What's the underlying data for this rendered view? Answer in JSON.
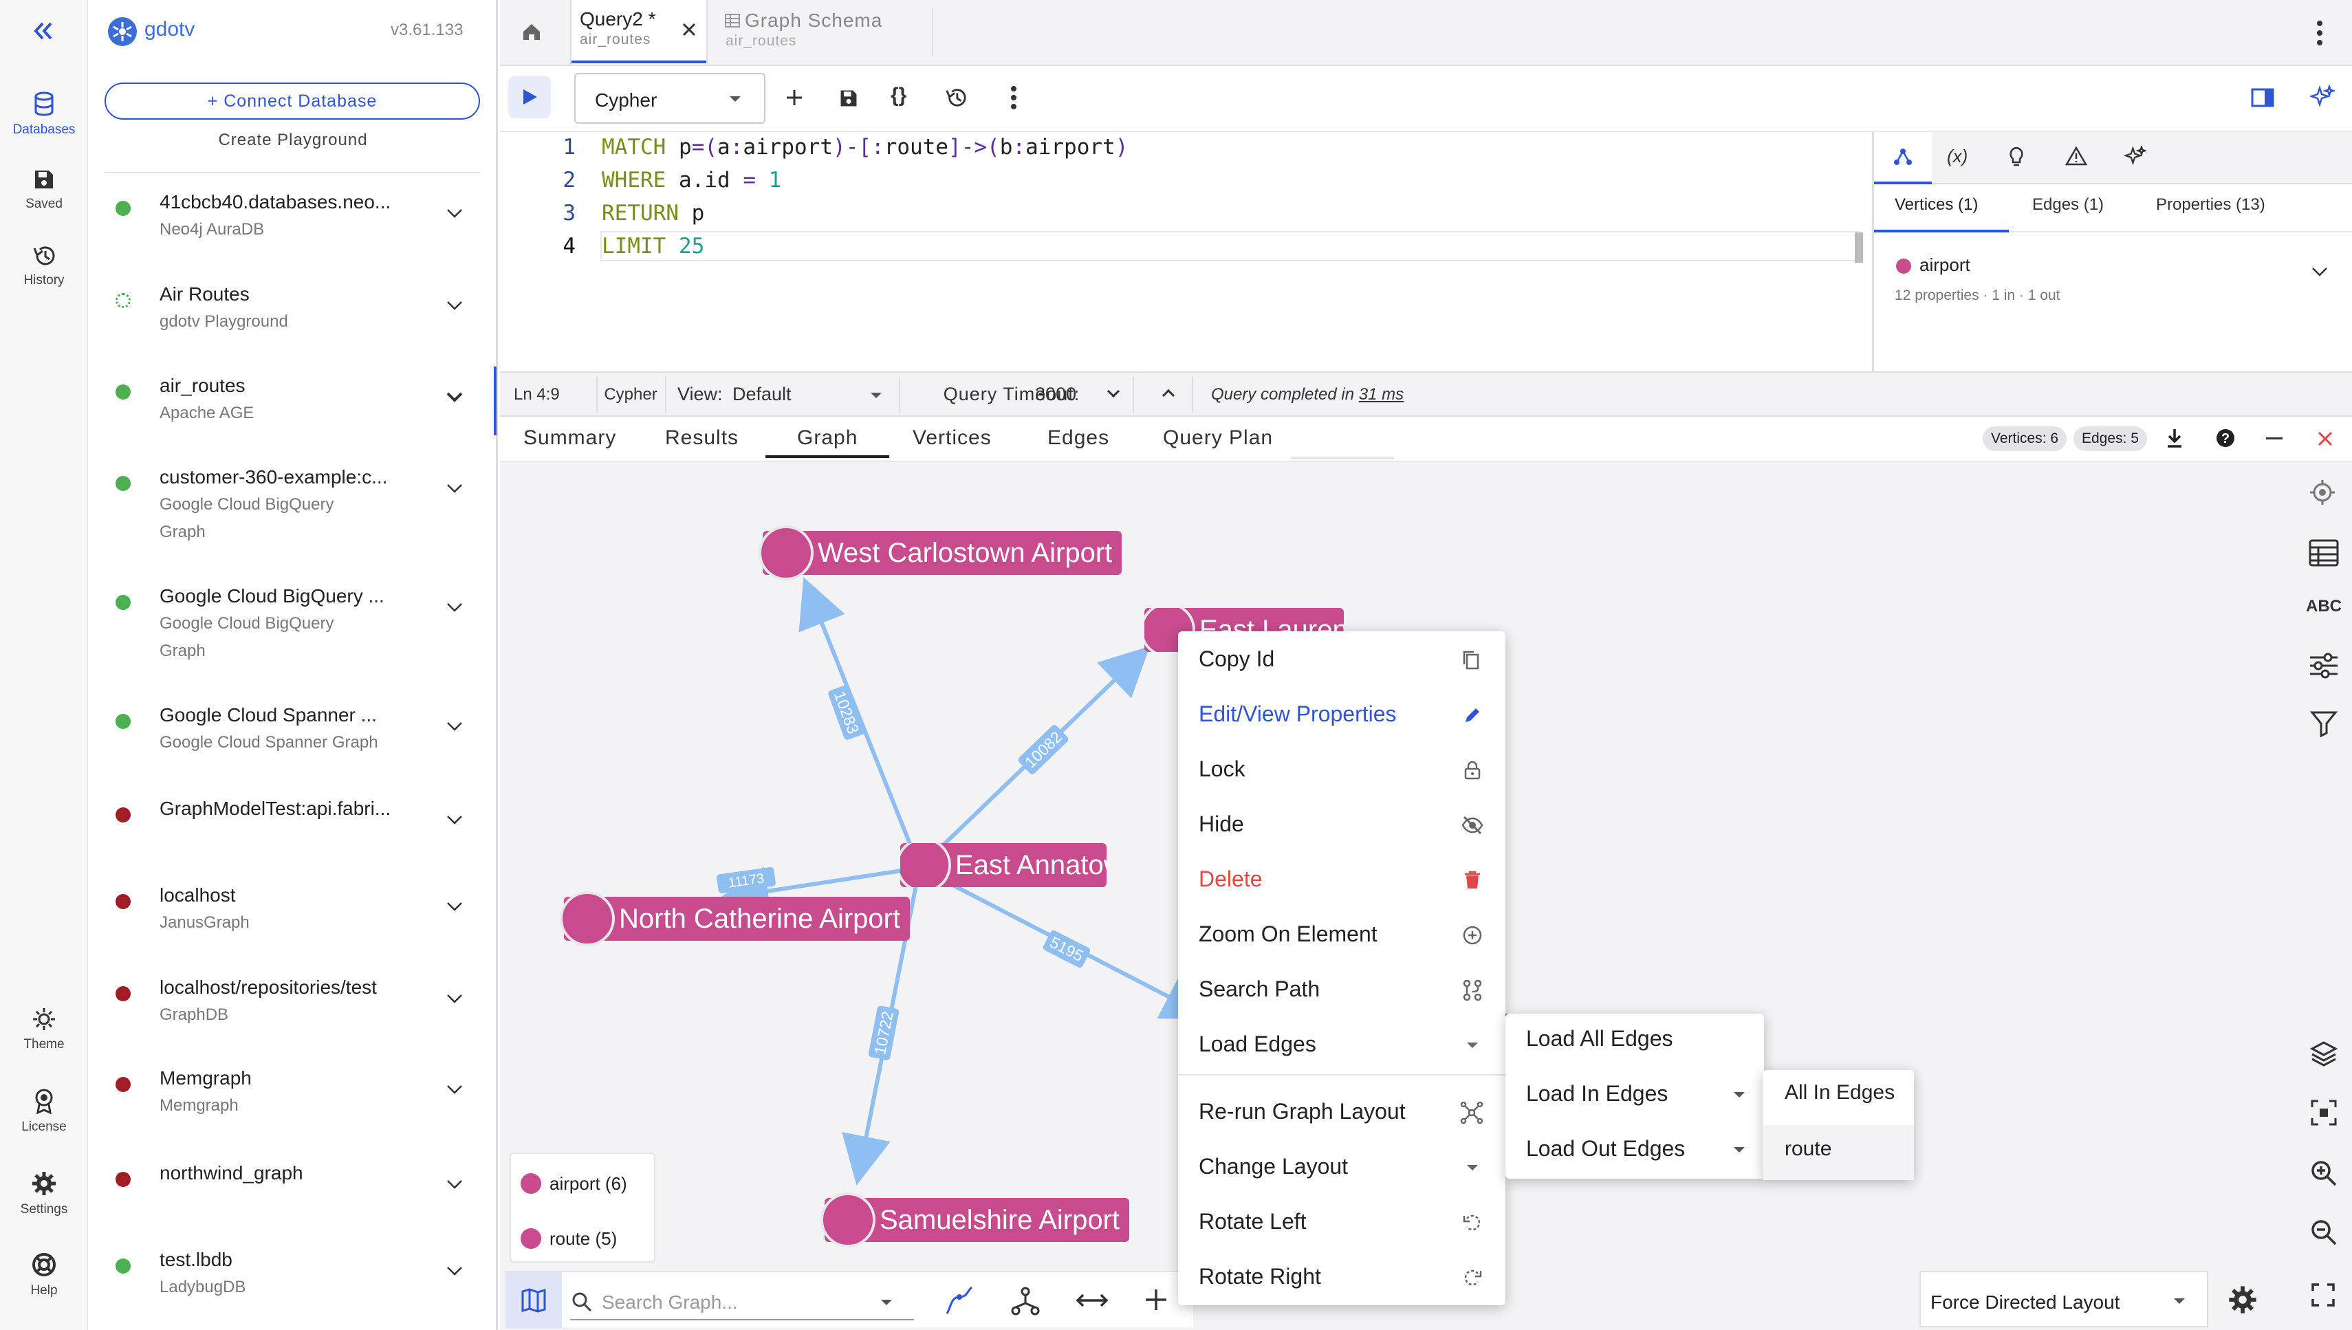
{
  "rail": {
    "collapse_icon": "double-chevron-left-icon",
    "items": [
      {
        "label": "Databases",
        "icon": "database-icon"
      },
      {
        "label": "Saved",
        "icon": "save-icon"
      },
      {
        "label": "History",
        "icon": "history-icon"
      }
    ],
    "bottom": [
      {
        "label": "Theme",
        "icon": "sun-icon"
      },
      {
        "label": "License",
        "icon": "badge-icon"
      },
      {
        "label": "Settings",
        "icon": "gear-icon"
      },
      {
        "label": "Help",
        "icon": "lifebuoy-icon"
      }
    ]
  },
  "sidebar": {
    "brand": "gdotv",
    "version": "v3.61.133",
    "connect_label": "+  Connect Database",
    "playground_label": "Create Playground",
    "connections": [
      {
        "name": "41cbcb40.databases.neo...",
        "sub": [
          "Neo4j AuraDB"
        ],
        "status": "#4caf50"
      },
      {
        "name": "Air Routes",
        "sub": [
          "gdotv Playground"
        ],
        "status": "playground"
      },
      {
        "name": "air_routes",
        "sub": [
          "Apache AGE"
        ],
        "status": "#4caf50",
        "active": true
      },
      {
        "name": "customer-360-example:c...",
        "sub": [
          "Google Cloud BigQuery",
          "Graph"
        ],
        "status": "#4caf50"
      },
      {
        "name": "Google Cloud BigQuery ...",
        "sub": [
          "Google Cloud BigQuery",
          "Graph"
        ],
        "status": "#4caf50"
      },
      {
        "name": "Google Cloud Spanner ...",
        "sub": [
          "Google Cloud Spanner Graph"
        ],
        "status": "#4caf50"
      },
      {
        "name": "GraphModelTest:api.fabri...",
        "sub": [],
        "status": "#a01d26"
      },
      {
        "name": "localhost",
        "sub": [
          "JanusGraph"
        ],
        "status": "#a01d26"
      },
      {
        "name": "localhost/repositories/test",
        "sub": [
          "GraphDB"
        ],
        "status": "#a01d26"
      },
      {
        "name": "Memgraph",
        "sub": [
          "Memgraph"
        ],
        "status": "#a01d26"
      },
      {
        "name": "northwind_graph",
        "sub": [],
        "status": "#a01d26"
      },
      {
        "name": "test.lbdb",
        "sub": [
          "LadybugDB"
        ],
        "status": "#4caf50"
      }
    ]
  },
  "tabs": [
    {
      "title": "Query2 *",
      "sub": "air_routes",
      "active": true
    },
    {
      "title": "Graph Schema",
      "sub": "air_routes",
      "active": false
    }
  ],
  "toolbar": {
    "language": "Cypher"
  },
  "editor": {
    "lines": [
      {
        "n": "1",
        "code": "MATCH p=(a:airport)-[:route]->(b:airport)"
      },
      {
        "n": "2",
        "code": "WHERE a.id = 1"
      },
      {
        "n": "3",
        "code": "RETURN p"
      },
      {
        "n": "4",
        "code": "LIMIT 25"
      }
    ]
  },
  "inspector": {
    "tabs": [
      "Vertices (1)",
      "Edges (1)",
      "Properties (13)"
    ],
    "item_label": "airport",
    "item_meta": "12 properties · 1 in · 1 out"
  },
  "status": {
    "position": "Ln 4:9",
    "language": "Cypher",
    "view_label": "View:",
    "view_value": "Default",
    "timeout_label": "Query Timeout:",
    "timeout_value": "3000",
    "message": "Query completed in",
    "duration": "31 ms"
  },
  "result_tabs": [
    "Summary",
    "Results",
    "Graph",
    "Vertices",
    "Edges",
    "Query Plan"
  ],
  "result_counts": {
    "vertices": "Vertices: 6",
    "edges": "Edges: 5"
  },
  "graph": {
    "nodes": [
      "West Carlostown Airport",
      "East Lauren Airport",
      "East Annatown Airport",
      "North Catherine Airport",
      "Samuelshire Airport"
    ],
    "edge_labels": [
      "10283",
      "10082",
      "5195",
      "10722",
      "11173"
    ]
  },
  "legend": {
    "items": [
      "airport (6)",
      "route (5)"
    ]
  },
  "context_menu": {
    "items": [
      "Copy Id",
      "Edit/View Properties",
      "Lock",
      "Hide",
      "Delete",
      "Zoom On Element",
      "Search Path",
      "Load Edges",
      "Re-run Graph Layout",
      "Change Layout",
      "Rotate Left",
      "Rotate Right"
    ],
    "submenu": [
      "Load All Edges",
      "Load In Edges",
      "Load Out Edges"
    ],
    "submenu2": [
      "All In Edges",
      "route"
    ]
  },
  "bottom": {
    "search_placeholder": "Search Graph...",
    "layout": "Force Directed Layout"
  },
  "colors": {
    "accent": "#2f55d4",
    "node": "#c74b8d",
    "edge": "#8fbff2",
    "danger": "#e04848"
  }
}
